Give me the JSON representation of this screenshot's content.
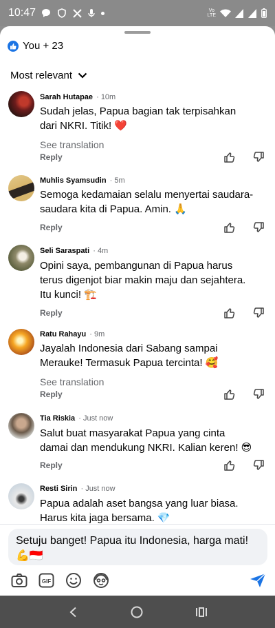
{
  "status_bar": {
    "time": "10:47",
    "network": "LTE",
    "network_top": "Vo"
  },
  "reactions": {
    "label": "You + 23"
  },
  "sort": {
    "label": "Most relevant"
  },
  "comments": [
    {
      "name": "Sarah Hutapae",
      "time": "10m",
      "text": "Sudah jelas, Papua bagian tak terpisahkan dari NKRI. Titik! ❤️",
      "see_translation": "See translation",
      "reply": "Reply"
    },
    {
      "name": "Muhlis Syamsudin",
      "time": "5m",
      "text": "Semoga kedamaian selalu menyertai saudara-saudara kita di Papua. Amin. 🙏",
      "reply": "Reply"
    },
    {
      "name": "Seli Saraspati",
      "time": "4m",
      "text": "Opini saya, pembangunan di Papua harus terus digenjot biar makin maju dan sejahtera. Itu kunci! 🏗️",
      "reply": "Reply"
    },
    {
      "name": "Ratu Rahayu",
      "time": "9m",
      "text": "Jayalah Indonesia dari Sabang sampai Merauke! Termasuk Papua tercinta! 🥰",
      "see_translation": "See translation",
      "reply": "Reply"
    },
    {
      "name": "Tia Riskia",
      "time": "Just now",
      "text": "Salut buat masyarakat Papua yang cinta damai dan mendukung NKRI. Kalian keren! 😎",
      "reply": "Reply"
    },
    {
      "name": "Resti Sirin",
      "time": "Just now",
      "text": "Papua adalah aset bangsa yang luar biasa. Harus kita jaga bersama. 💎"
    }
  ],
  "composer": {
    "value": "Setuju banget! Papua itu Indonesia, harga mati! 💪🇮🇩"
  },
  "colors": {
    "accent": "#1b74e4",
    "secondary_text": "#65676b",
    "input_bg": "#f0f2f5"
  },
  "icons": [
    "camera-icon",
    "gif-icon",
    "emoji-icon",
    "avatar-sticker-icon",
    "send-icon",
    "thumbs-up-icon",
    "thumbs-down-icon",
    "back-icon",
    "home-icon",
    "recents-icon"
  ]
}
